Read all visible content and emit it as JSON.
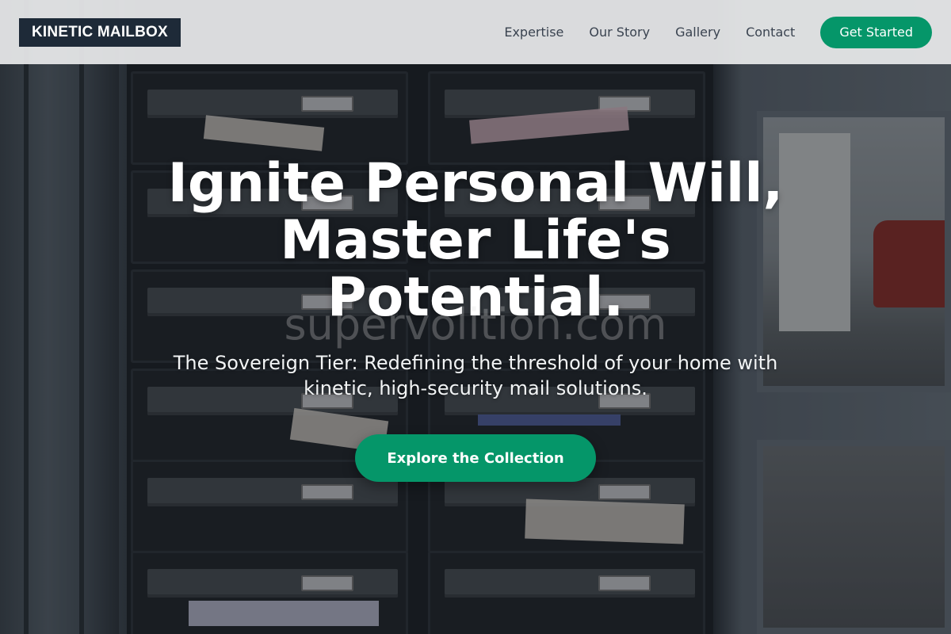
{
  "header": {
    "logo": "KINETIC MAILBOX",
    "nav": [
      {
        "label": "Expertise"
      },
      {
        "label": "Our Story"
      },
      {
        "label": "Gallery"
      },
      {
        "label": "Contact"
      }
    ],
    "cta_label": "Get Started"
  },
  "hero": {
    "title": "Ignite Personal Will, Master Life's Potential.",
    "subtitle": "The Sovereign Tier: Redefining the threshold of your home with kinetic, high-security mail solutions.",
    "button_label": "Explore the Collection",
    "watermark": "supervolition.com"
  },
  "colors": {
    "accent": "#059669",
    "logo_bg": "#1e2a38",
    "header_bg": "#e8eaeb"
  }
}
